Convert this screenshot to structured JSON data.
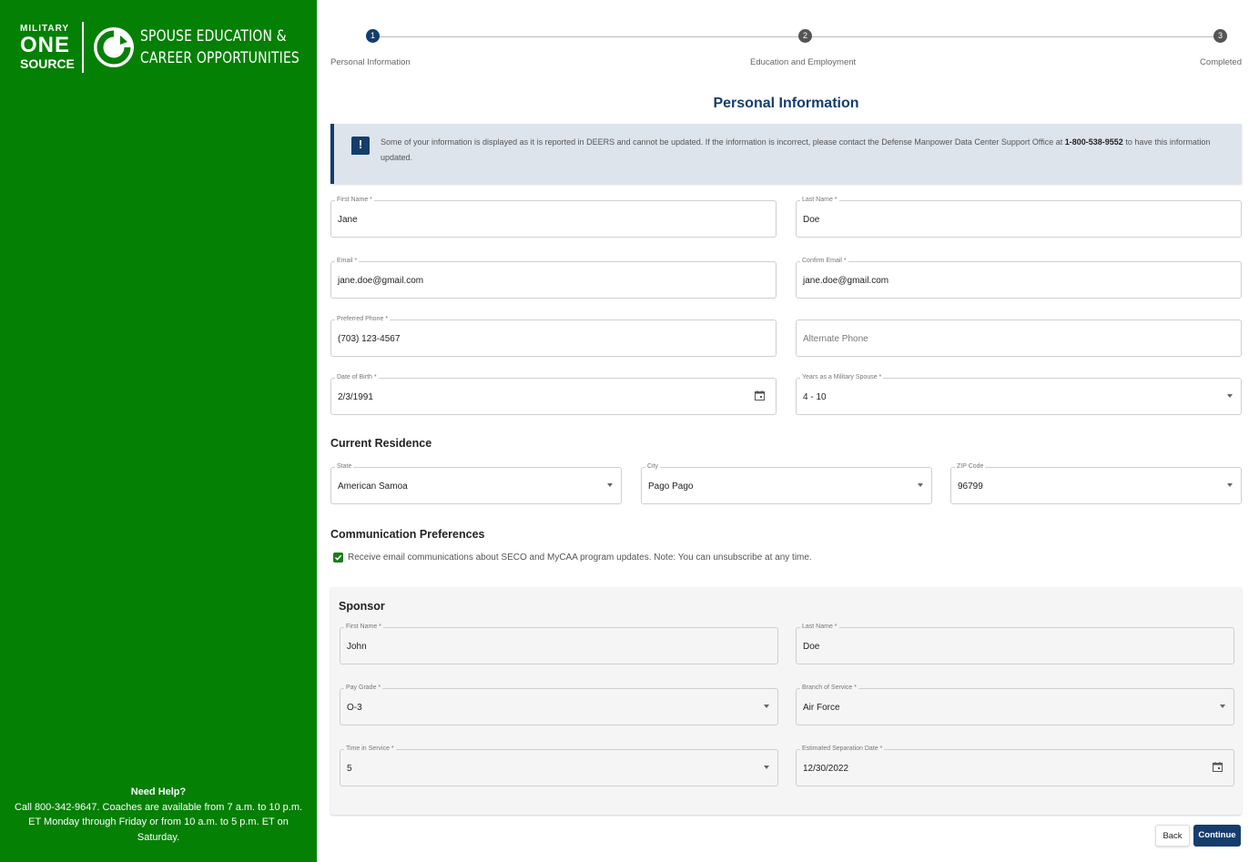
{
  "sidebar": {
    "logo_military": "MILITARY",
    "logo_one": "ONE",
    "logo_source": "SOURCE",
    "program_line1": "SPOUSE EDUCATION &",
    "program_line2": "CAREER OPPORTUNITIES",
    "help_title": "Need Help?",
    "help_text": "Call 800-342-9647. Coaches are available from 7 a.m. to 10 p.m. ET Monday through Friday or from 10 a.m. to 5 p.m. ET on Saturday."
  },
  "stepper": {
    "steps": [
      {
        "number": "1",
        "label": "Personal Information",
        "active": true
      },
      {
        "number": "2",
        "label": "Education and Employment",
        "active": false
      },
      {
        "number": "3",
        "label": "Completed",
        "active": false
      }
    ]
  },
  "page_title": "Personal Information",
  "alert": {
    "text_before": "Some of your information is displayed as it is reported in DEERS and cannot be updated. If the information is incorrect, please contact the Defense Manpower Data Center Support Office at ",
    "phone": "1-800-538-9552",
    "text_after": " to have this information updated."
  },
  "personal": {
    "first_name": {
      "label": "First Name *",
      "value": "Jane"
    },
    "last_name": {
      "label": "Last Name *",
      "value": "Doe"
    },
    "email": {
      "label": "Email *",
      "value": "jane.doe@gmail.com"
    },
    "confirm_email": {
      "label": "Confirm Email *",
      "value": "jane.doe@gmail.com"
    },
    "preferred_phone": {
      "label": "Preferred Phone *",
      "value": "(703) 123-4567"
    },
    "alternate_phone": {
      "placeholder": "Alternate Phone"
    },
    "dob": {
      "label": "Date of Birth *",
      "value": "2/3/1991"
    },
    "years_spouse": {
      "label": "Years as a Military Spouse *",
      "value": "4 - 10"
    }
  },
  "residence": {
    "title": "Current Residence",
    "state": {
      "label": "State",
      "value": "American Samoa"
    },
    "city": {
      "label": "City",
      "value": "Pago Pago"
    },
    "zip": {
      "label": "ZIP Code",
      "value": "96799"
    }
  },
  "communication": {
    "title": "Communication Preferences",
    "checkbox_label": "Receive email communications about SECO and MyCAA program updates. Note: You can unsubscribe at any time.",
    "checked": true
  },
  "sponsor": {
    "title": "Sponsor",
    "first_name": {
      "label": "First Name *",
      "value": "John"
    },
    "last_name": {
      "label": "Last Name *",
      "value": "Doe"
    },
    "pay_grade": {
      "label": "Pay Grade *",
      "value": "O-3"
    },
    "branch": {
      "label": "Branch of Service *",
      "value": "Air Force"
    },
    "time_in_service": {
      "label": "Time in Service *",
      "value": "5"
    },
    "separation_date": {
      "label": "Estimated Separation Date *",
      "value": "12/30/2022"
    }
  },
  "buttons": {
    "back": "Back",
    "continue": "Continue"
  },
  "colors": {
    "sidebar_green": "#048004",
    "navy": "#143d6e",
    "alert_bg": "#dee4ec",
    "step_inactive": "#555555",
    "checkbox_green": "#1b7d1b"
  }
}
